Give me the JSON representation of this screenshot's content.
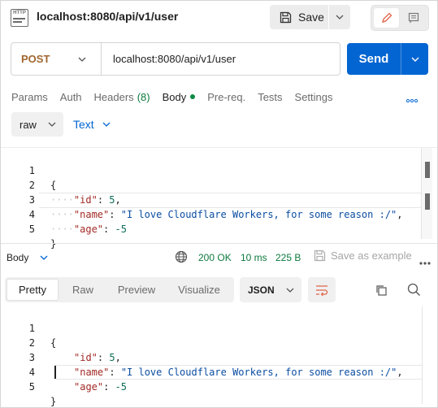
{
  "header": {
    "tab_icon": "http-file-icon",
    "tab_title": "localhost:8080/api/v1/user",
    "save_label": "Save"
  },
  "request": {
    "method": "POST",
    "url": "localhost:8080/api/v1/user",
    "send_label": "Send",
    "tabs": [
      {
        "label": "Params"
      },
      {
        "label": "Auth"
      },
      {
        "label": "Headers",
        "count": "(8)"
      },
      {
        "label": "Body",
        "active": true
      },
      {
        "label": "Pre-req."
      },
      {
        "label": "Tests"
      },
      {
        "label": "Settings"
      }
    ],
    "body_mode": "raw",
    "body_format": "Text",
    "body_lines": [
      {
        "num": "1",
        "text": "{"
      },
      {
        "num": "2",
        "key": "\"id\"",
        "value": "5",
        "trail": ","
      },
      {
        "num": "3",
        "key": "\"name\"",
        "value": "\"I love Cloudflare Workers, for some reason :/\"",
        "trail": ","
      },
      {
        "num": "4",
        "key": "\"age\"",
        "value": "-5",
        "trail": ""
      },
      {
        "num": "5",
        "text": "}"
      }
    ]
  },
  "response": {
    "label": "Body",
    "status": "200 OK",
    "time": "10 ms",
    "size": "225 B",
    "save_example": "Save as example",
    "views": [
      "Pretty",
      "Raw",
      "Preview",
      "Visualize"
    ],
    "active_view": "Pretty",
    "format": "JSON",
    "lines": [
      {
        "num": "1",
        "text": "{"
      },
      {
        "num": "2",
        "key": "\"id\"",
        "value": "5",
        "trail": ","
      },
      {
        "num": "3",
        "key": "\"name\"",
        "value": "\"I love Cloudflare Workers, for some reason :/\"",
        "trail": ","
      },
      {
        "num": "4",
        "key": "\"age\"",
        "value": "-5",
        "trail": ""
      },
      {
        "num": "5",
        "text": "}"
      }
    ]
  },
  "colors": {
    "accent": "#0265d2",
    "method": "#a1662f",
    "status": "#0c7a3e"
  }
}
